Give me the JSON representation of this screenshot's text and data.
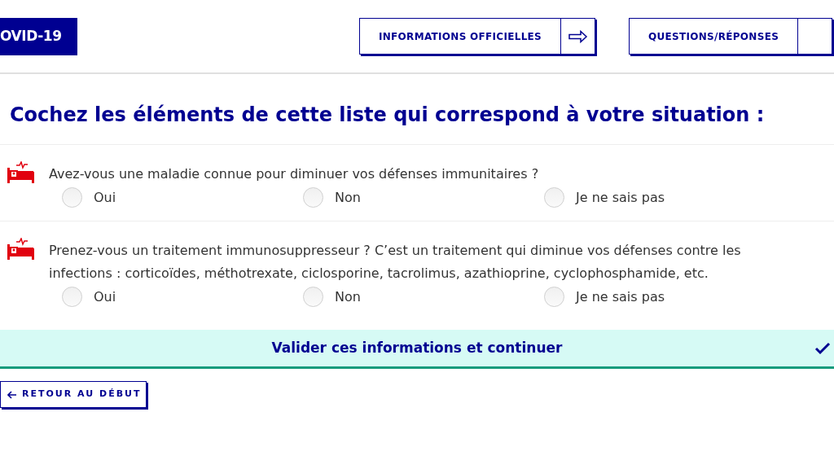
{
  "header": {
    "badge": "OVID-19",
    "links": [
      {
        "label": "INFORMATIONS OFFICIELLES"
      },
      {
        "label": "QUESTIONS/RÉPONSES"
      }
    ]
  },
  "heading": "Cochez les éléments de cette liste qui correspond à votre situation :",
  "questions": [
    {
      "text": "Avez-vous une maladie connue pour diminuer vos défenses immunitaires ?",
      "options": [
        {
          "label": "Oui",
          "selected": false
        },
        {
          "label": "Non",
          "selected": false
        },
        {
          "label": "Je ne sais pas",
          "selected": false
        }
      ]
    },
    {
      "text": "Prenez-vous un traitement immunosuppresseur ? C’est un traitement qui diminue vos défenses contre les infections : corticoïdes, méthotrexate, ciclosporine, tacrolimus, azathioprine, cyclophosphamide, etc.",
      "options": [
        {
          "label": "Oui",
          "selected": false
        },
        {
          "label": "Non",
          "selected": false
        },
        {
          "label": "Je ne sais pas",
          "selected": false
        }
      ]
    }
  ],
  "submit": {
    "label": "Valider ces informations et continuer"
  },
  "back": {
    "label": "RETOUR AU DÉBUT"
  }
}
